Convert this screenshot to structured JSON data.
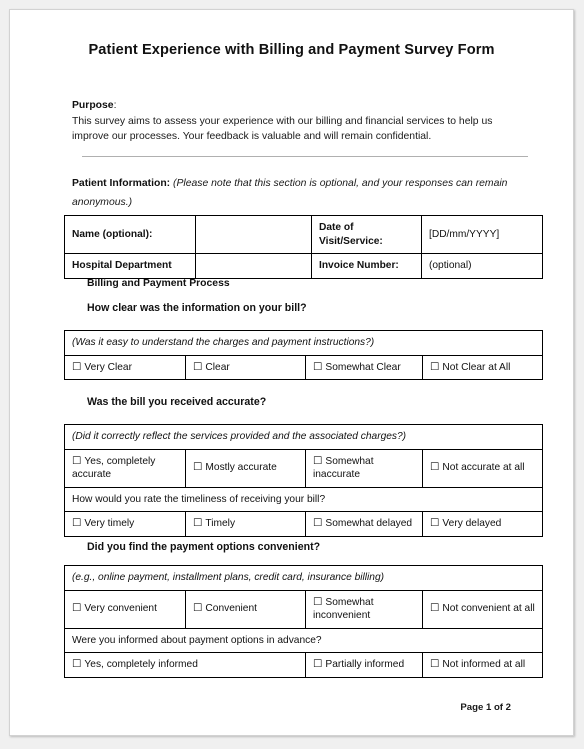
{
  "document": {
    "title": "Patient Experience with Billing and Payment Survey Form",
    "purpose_label": "Purpose",
    "purpose_colon": ":",
    "purpose_text": "This survey aims to assess your experience with our billing and financial services to help us improve our processes. Your feedback is valuable and will remain confidential.",
    "footer": "Page 1 of 2"
  },
  "patient_information": {
    "heading_bold": "Patient Information:",
    "heading_note": " (Please note that this section is optional, and your responses can remain anonymous.)",
    "rows": [
      {
        "label_left": "Name (optional):",
        "value_left": "",
        "label_right": "Date of Visit/Service:",
        "value_right": "[DD/mm/YYYY]"
      },
      {
        "label_left": "Hospital Department",
        "value_left": "",
        "label_right": "Invoice Number:",
        "value_right": "(optional)"
      }
    ]
  },
  "billing_section": {
    "heading": "Billing and Payment Process"
  },
  "q1": {
    "question": "How clear was the information on your bill?",
    "prompt": "(Was it easy to understand the charges and payment instructions?)",
    "options": [
      "Very Clear",
      "Clear",
      "Somewhat Clear",
      "Not Clear at All"
    ]
  },
  "q2": {
    "question": "Was the bill you received accurate?",
    "prompt": "(Did it correctly reflect the services provided and the associated charges?)",
    "options": [
      "Yes, completely accurate",
      "Mostly accurate",
      "Somewhat inaccurate",
      "Not accurate at all"
    ],
    "sub_question": "How would you rate the timeliness of receiving your bill?",
    "sub_options": [
      "Very timely",
      "Timely",
      "Somewhat delayed",
      "Very delayed"
    ]
  },
  "q3": {
    "question": "Did you find the payment options convenient?",
    "prompt": "(e.g., online payment, installment plans, credit card, insurance billing)",
    "options": [
      "Very convenient",
      "Convenient",
      "Somewhat inconvenient",
      "Not convenient at all"
    ],
    "sub_question": "Were you informed about payment options in advance?",
    "sub_options": [
      "Yes, completely informed",
      "Partially informed",
      "Not informed at all"
    ]
  },
  "icons": {
    "checkbox": "☐"
  }
}
